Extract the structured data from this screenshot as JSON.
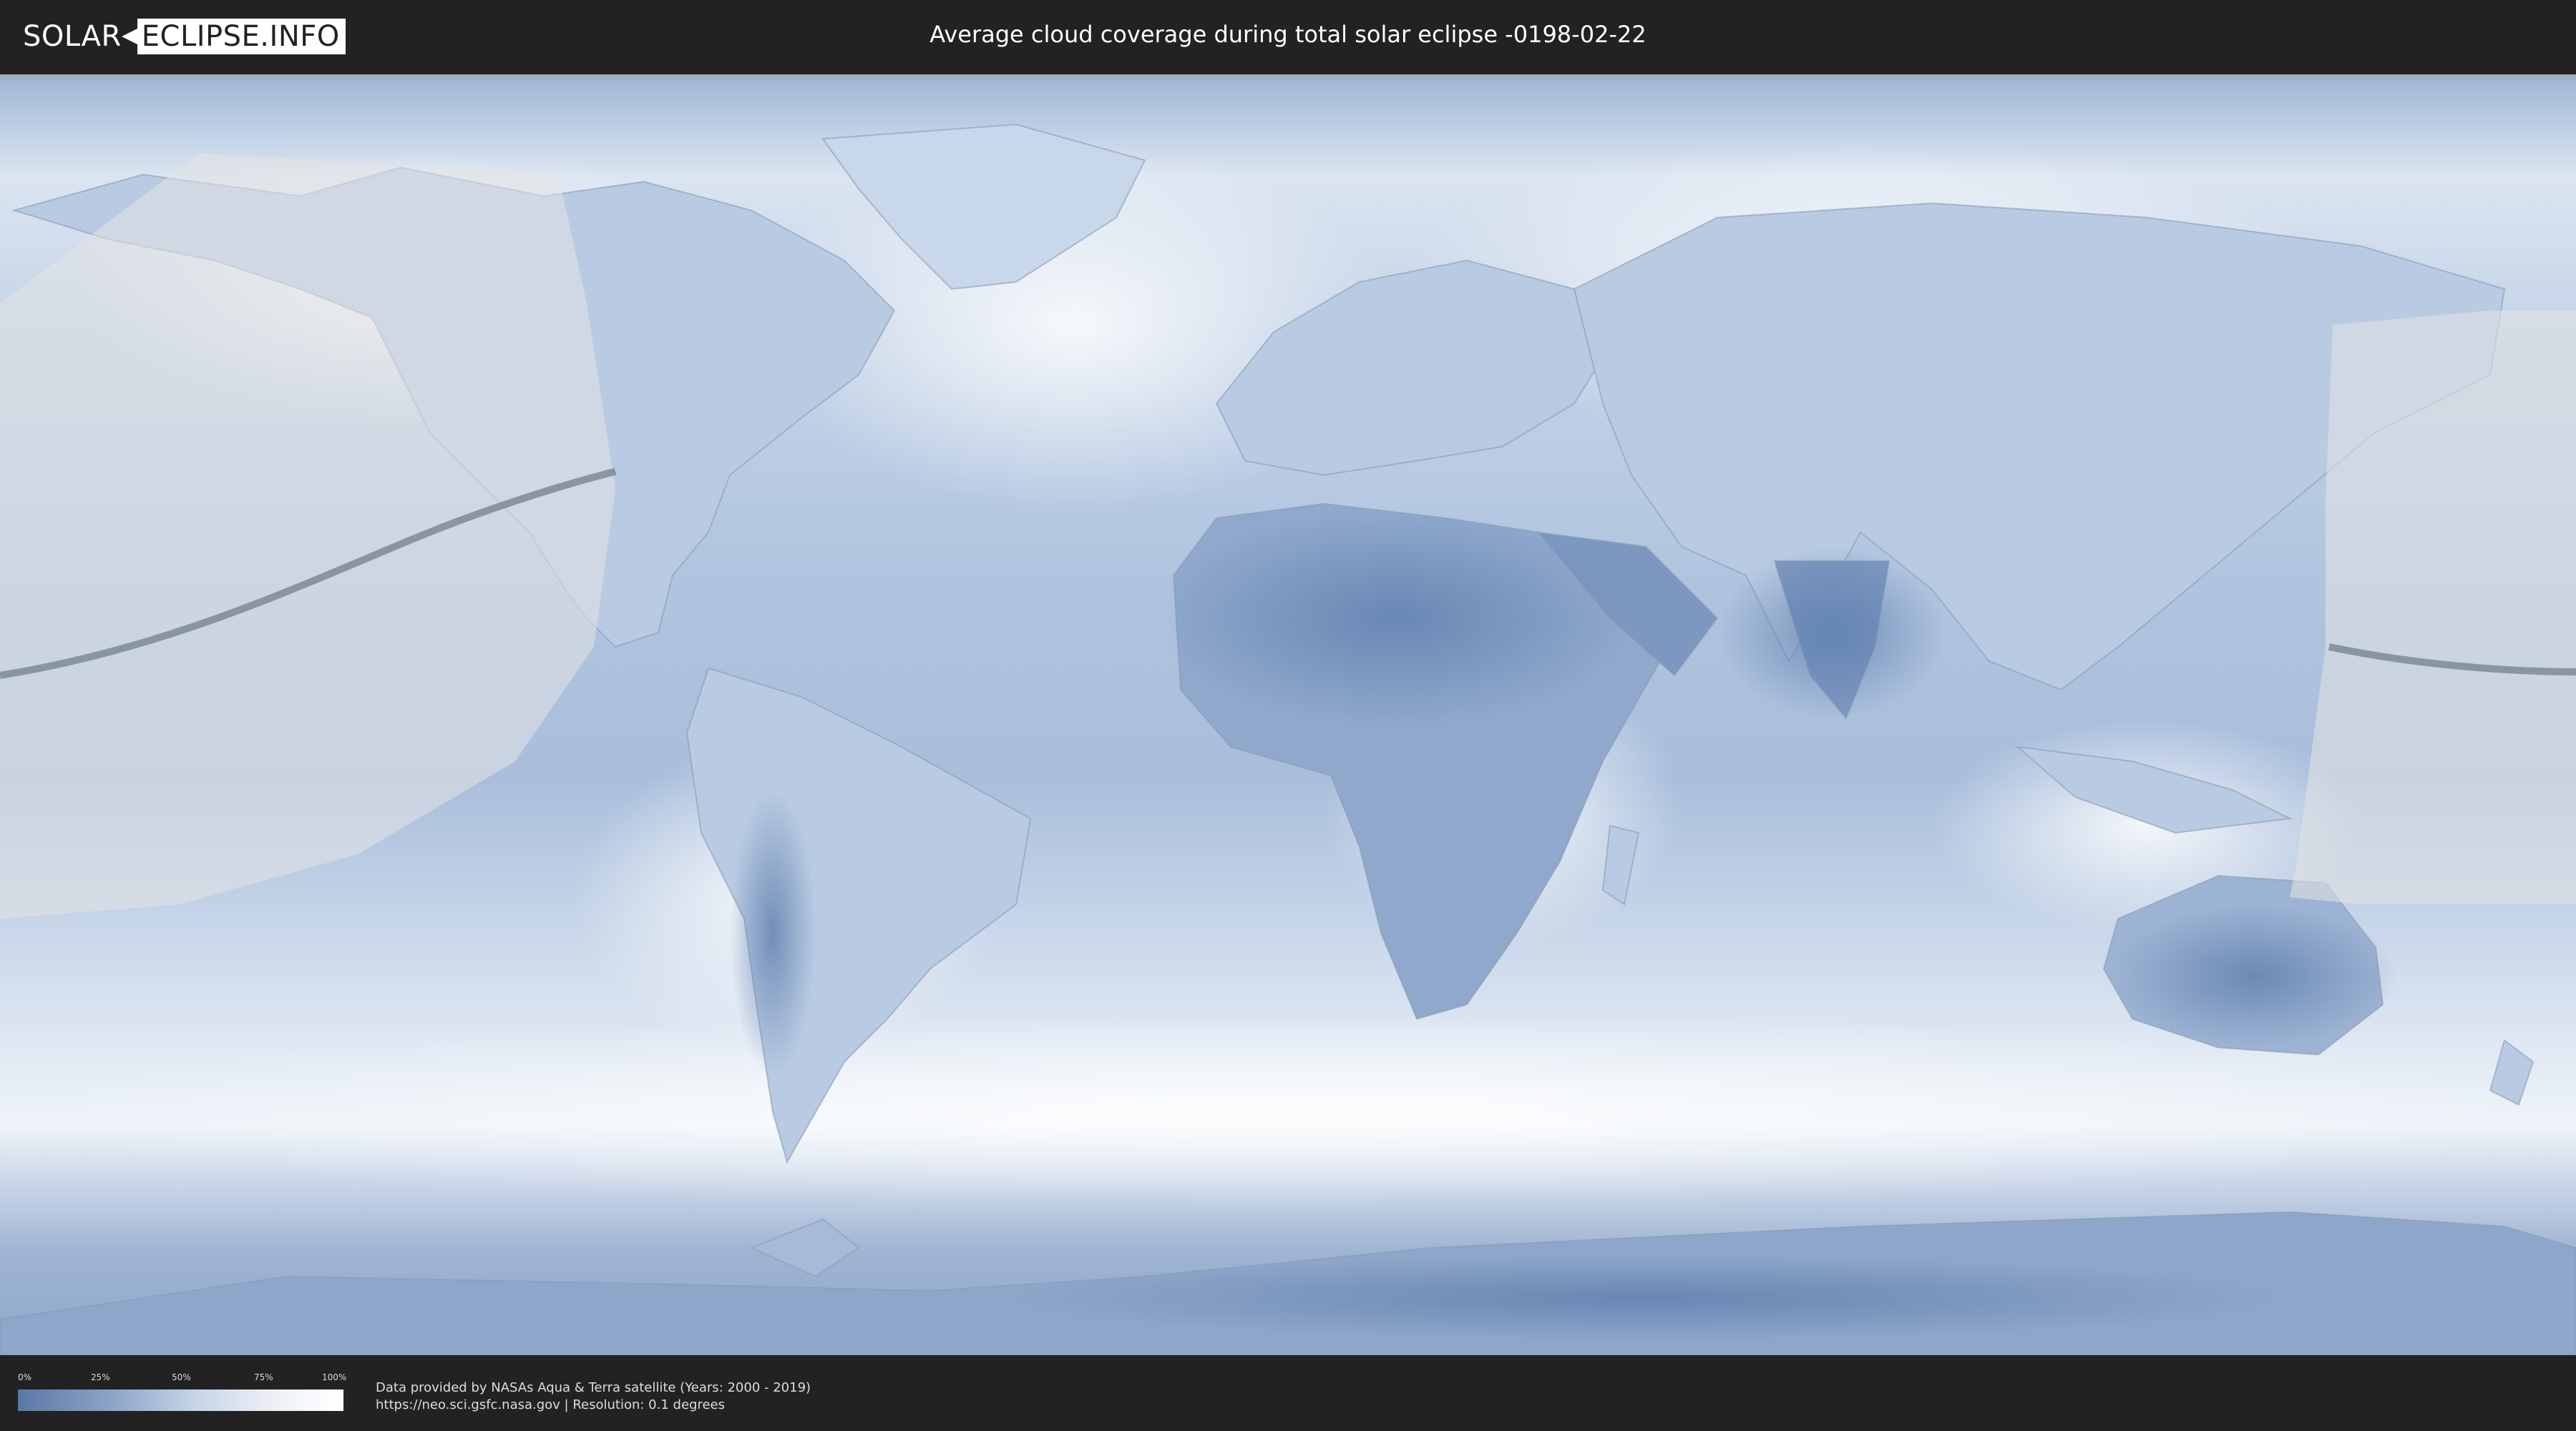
{
  "header": {
    "logo_left": "SOLAR",
    "logo_right": "ECLIPSE.INFO",
    "title": "Average cloud coverage during total solar eclipse -0198-02-22"
  },
  "map": {
    "colors": {
      "ocean": "#a9bedb",
      "ocean_light": "#dbe5f1",
      "land_clear": "#6f8cb8",
      "cloud": "#f7f9fc",
      "eclipse_path": "#7f8a96",
      "visibility_zone": "#e7e7e7"
    }
  },
  "legend": {
    "labels": [
      "0%",
      "25%",
      "50%",
      "75%",
      "100%"
    ],
    "gradient_from": "#5a78a6",
    "gradient_to": "#ffffff"
  },
  "credits": {
    "line1": "Data provided by NASAs Aqua & Terra satellite (Years: 2000 - 2019)",
    "line2": "https://neo.sci.gsfc.nasa.gov | Resolution: 0.1 degrees"
  }
}
